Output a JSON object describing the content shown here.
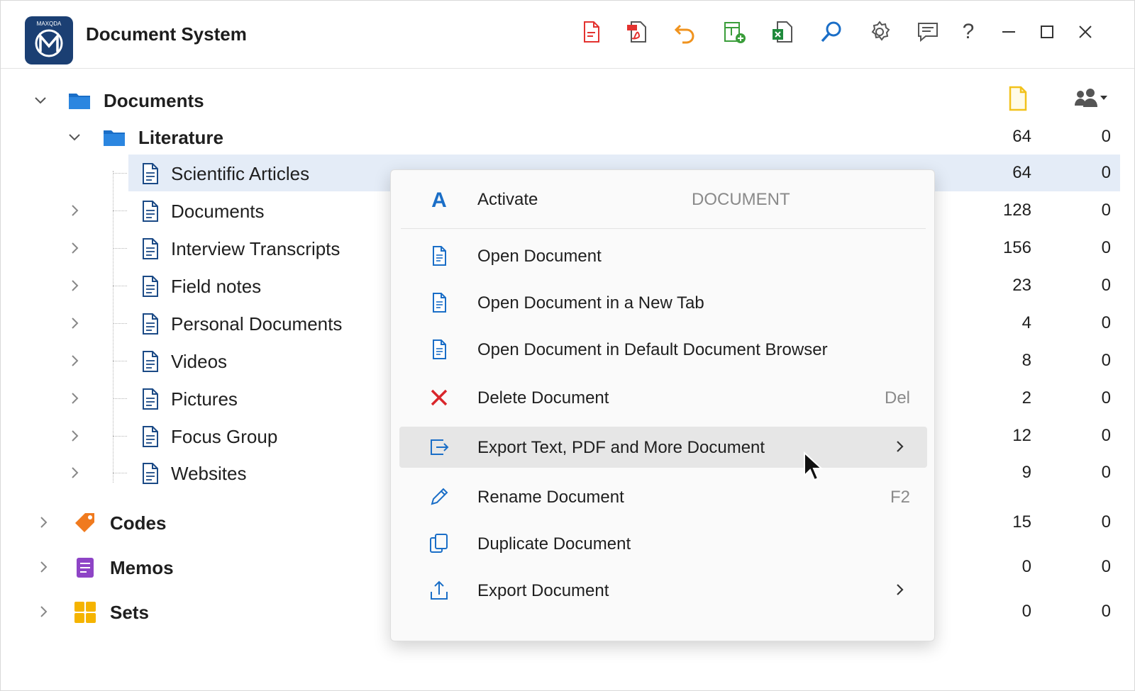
{
  "app": {
    "title": "Document System",
    "logo_text": "MAXQDA"
  },
  "toolbar": {
    "icons": [
      "new-document-icon",
      "pdf-export-icon",
      "undo-icon",
      "add-table-icon",
      "excel-export-icon",
      "search-icon",
      "gear-icon",
      "comment-icon",
      "help-icon"
    ],
    "window_controls": [
      "minimize-icon",
      "maximize-icon",
      "close-icon"
    ],
    "help_label": "?"
  },
  "columns": {
    "docs_icon": "document-count-icon",
    "users_icon": "users-dropdown-icon"
  },
  "tree": {
    "root": {
      "label": "Documents"
    },
    "literature": {
      "label": "Literature",
      "docs": "64",
      "users": "0"
    },
    "items": [
      {
        "label": "Scientific Articles",
        "docs": "64",
        "users": "0"
      },
      {
        "label": "Documents",
        "docs": "128",
        "users": "0"
      },
      {
        "label": "Interview Transcripts",
        "docs": "156",
        "users": "0"
      },
      {
        "label": "Field notes",
        "docs": "23",
        "users": "0"
      },
      {
        "label": "Personal Documents",
        "docs": "4",
        "users": "0"
      },
      {
        "label": "Videos",
        "docs": "8",
        "users": "0"
      },
      {
        "label": "Pictures",
        "docs": "2",
        "users": "0"
      },
      {
        "label": "Focus Group",
        "docs": "12",
        "users": "0"
      },
      {
        "label": "Websites",
        "docs": "9",
        "users": "0"
      }
    ],
    "codes": {
      "label": "Codes",
      "docs": "15",
      "users": "0"
    },
    "memos": {
      "label": "Memos",
      "docs": "0",
      "users": "0"
    },
    "sets": {
      "label": "Sets",
      "docs": "0",
      "users": "0"
    }
  },
  "context_menu": {
    "header": {
      "label": "Activate",
      "tag": "DOCUMENT"
    },
    "items": [
      {
        "label": "Open Document",
        "shortcut": ""
      },
      {
        "label": "Open Document in a New Tab",
        "shortcut": ""
      },
      {
        "label": "Open Document in Default Document Browser",
        "shortcut": ""
      },
      {
        "label": "Delete Document",
        "shortcut": "Del"
      },
      {
        "label": "Export Text, PDF and More Document",
        "shortcut": ""
      },
      {
        "label": "Rename Document",
        "shortcut": "F2"
      },
      {
        "label": "Duplicate Document",
        "shortcut": ""
      },
      {
        "label": "Export Document",
        "shortcut": ""
      }
    ]
  },
  "colors": {
    "selection": "#e4ecf7",
    "accent_blue": "#1a6ec7",
    "delete_red": "#d9262b",
    "codes_orange": "#f07a1e",
    "memos_purple": "#8e44c6",
    "sets_yellow": "#f5b400"
  }
}
